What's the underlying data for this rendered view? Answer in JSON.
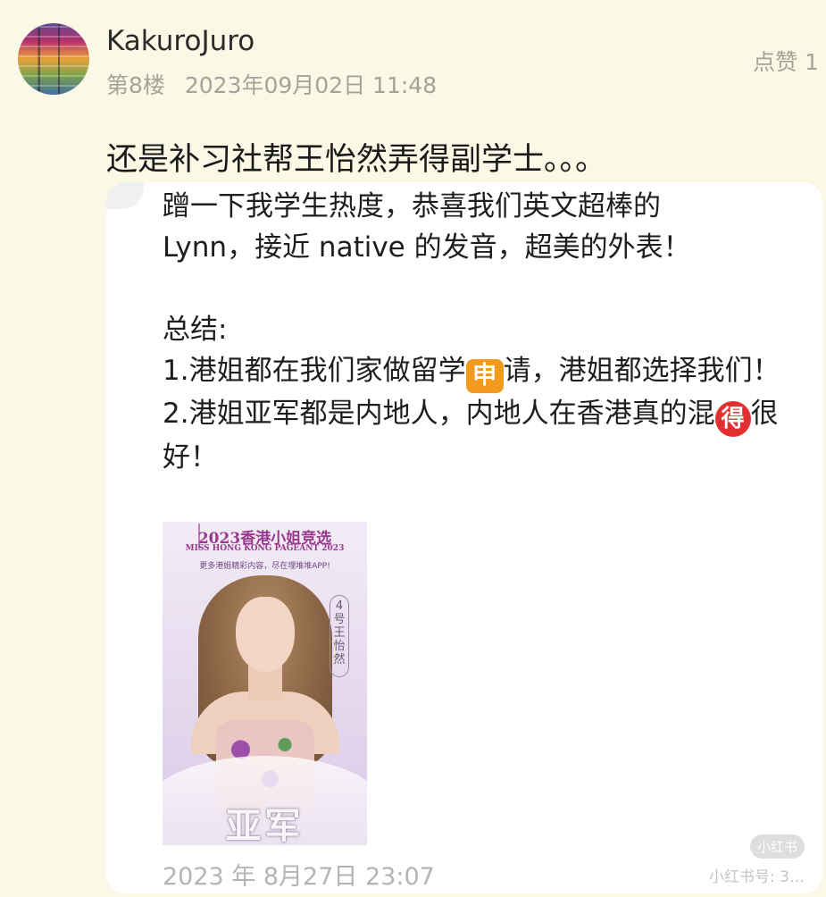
{
  "post": {
    "username": "KakuroJuro",
    "floor": "第8楼",
    "timestamp": "2023年09月02日 11:48",
    "like_label": "点赞 1",
    "comment": "还是补习社帮王怡然弄得副学士。。。"
  },
  "card": {
    "line1": "蹭一下我学生热度，恭喜我们英文超棒的",
    "line2": "Lynn，接近 native 的发音，超美的外表！",
    "summary_label": "总结:",
    "item1_before": "1.港姐都在我们家做留学",
    "item1_emoji": "申",
    "item1_after": "请，港姐都选择我们！",
    "item2_before": "2.港姐亚军都是内地人，内地人在香港真的混",
    "item2_emoji": "得",
    "item2_after": "很好！",
    "date": "2023 年 8月27日 23:07",
    "watermark_logo": "小红书",
    "watermark_text": "小红书号: 3…"
  },
  "photo": {
    "title": "2023香港小姐竞选",
    "subtitle": "MISS HONG KONG PAGEANT 2023",
    "promo": "更多港姐精彩内容，尽在埋堆堆APP!",
    "tag": "4号 王怡然",
    "rank": "亚军"
  }
}
